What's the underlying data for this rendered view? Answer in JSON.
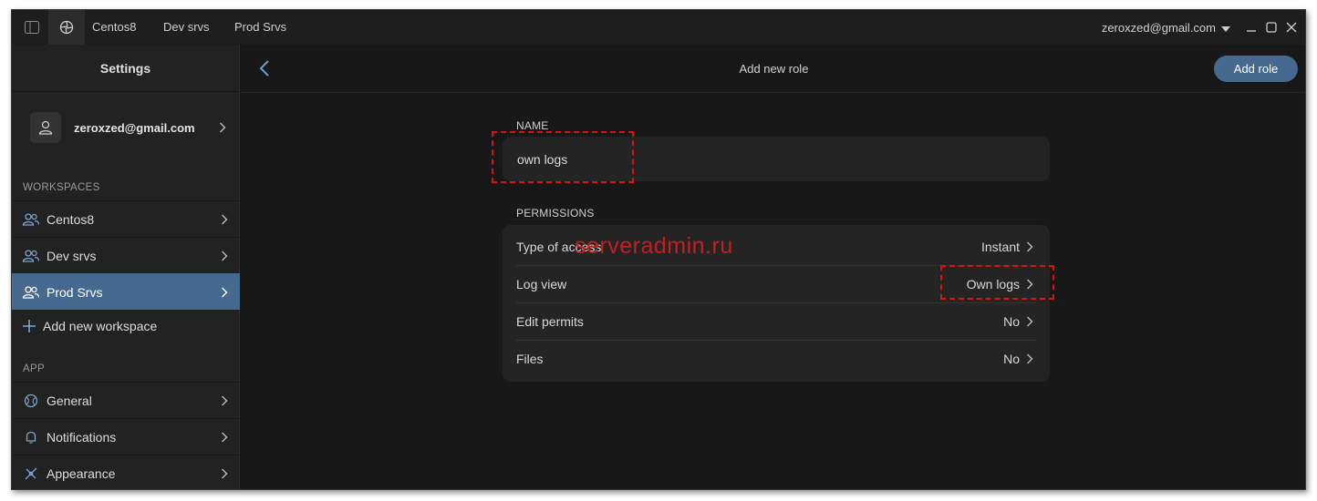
{
  "titlebar": {
    "tabs": [
      "Centos8",
      "Dev srvs",
      "Prod Srvs"
    ],
    "account": "zeroxzed@gmail.com"
  },
  "sidebar": {
    "title": "Settings",
    "profile_email": "zeroxzed@gmail.com",
    "workspaces_label": "WORKSPACES",
    "workspaces": [
      {
        "label": "Centos8",
        "selected": false
      },
      {
        "label": "Dev srvs",
        "selected": false
      },
      {
        "label": "Prod Srvs",
        "selected": true
      }
    ],
    "add_workspace": "Add new workspace",
    "app_label": "APP",
    "app_items": [
      {
        "label": "General",
        "icon": "globe-icon"
      },
      {
        "label": "Notifications",
        "icon": "bell-icon"
      },
      {
        "label": "Appearance",
        "icon": "brush-icon"
      }
    ]
  },
  "main": {
    "title": "Add new role",
    "add_button": "Add role",
    "name_label": "NAME",
    "name_value": "own logs",
    "permissions_label": "PERMISSIONS",
    "permissions": [
      {
        "name": "Type of access",
        "value": "Instant"
      },
      {
        "name": "Log view",
        "value": "Own logs"
      },
      {
        "name": "Edit permits",
        "value": "No"
      },
      {
        "name": "Files",
        "value": "No"
      }
    ]
  },
  "watermark": "serveradmin.ru",
  "colors": {
    "accent": "#45698f",
    "background": "#181818",
    "sidebar": "#222222",
    "card": "#242424",
    "highlight": "#e01010"
  }
}
